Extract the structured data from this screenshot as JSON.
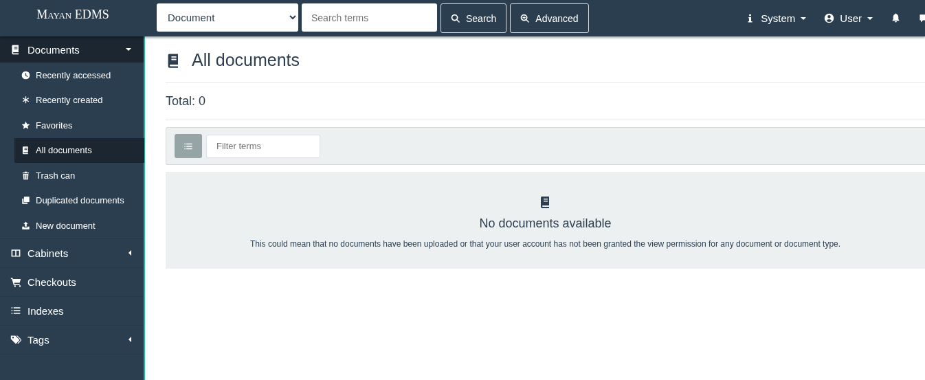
{
  "brand": "Mayan EDMS",
  "search": {
    "model": "Document",
    "placeholder": "Search terms",
    "search_button": "Search",
    "advanced_button": "Advanced"
  },
  "top_menu": [
    {
      "label": "System",
      "kind": "dropdown"
    },
    {
      "label": "User",
      "kind": "dropdown"
    },
    {
      "kind": "notifications"
    },
    {
      "kind": "messages"
    }
  ],
  "sidebar": {
    "items": [
      {
        "label": "Documents",
        "kind": "submenu",
        "expanded": true,
        "children": [
          {
            "label": "Recently accessed",
            "selected": false
          },
          {
            "label": "Recently created",
            "selected": false
          },
          {
            "label": "Favorites",
            "selected": false
          },
          {
            "label": "All documents",
            "selected": true
          },
          {
            "label": "Trash can",
            "selected": false
          },
          {
            "label": "Duplicated documents",
            "selected": false
          },
          {
            "label": "New document",
            "selected": false
          }
        ]
      },
      {
        "label": "Cabinets",
        "kind": "submenu",
        "expanded": false
      },
      {
        "label": "Checkouts",
        "kind": "link"
      },
      {
        "label": "Indexes",
        "kind": "link"
      },
      {
        "label": "Tags",
        "kind": "submenu",
        "expanded": false
      }
    ]
  },
  "page": {
    "title": "All documents",
    "total": "Total: 0",
    "filter_placeholder": "Filter terms",
    "empty": {
      "title": "No documents available",
      "text": "This could mean that no documents have been uploaded or that your user account has not been granted the view permission for any document or document type."
    }
  }
}
